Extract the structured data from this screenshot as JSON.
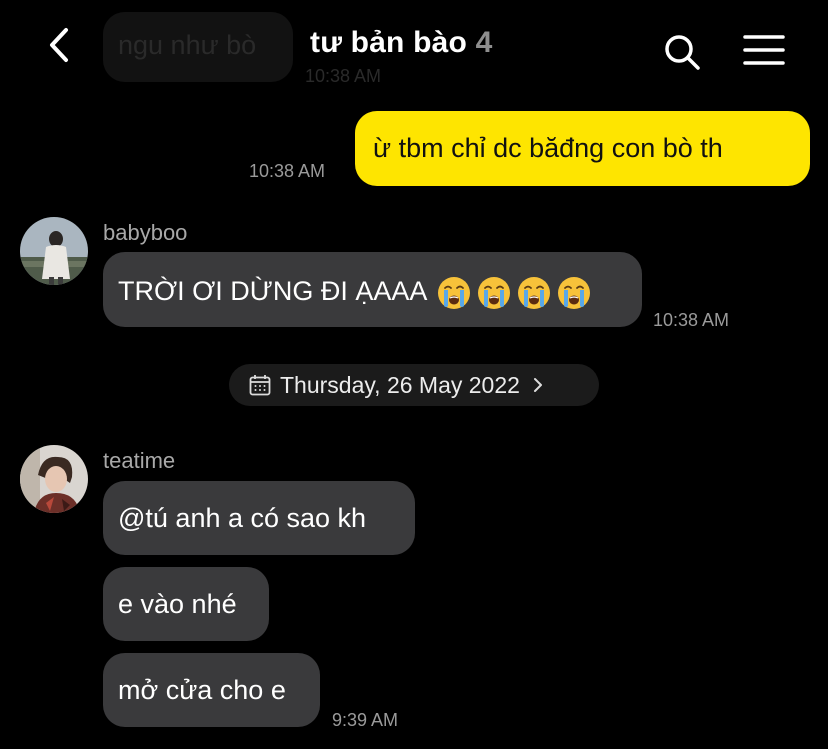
{
  "header": {
    "title": "tư bản bào",
    "member_count": "4",
    "back_icon": "chevron-left-icon",
    "search_icon": "search-icon",
    "menu_icon": "hamburger-menu-icon"
  },
  "ghost_message": {
    "text": "ngu như bò",
    "time": "10:38 AM"
  },
  "messages": [
    {
      "direction": "outgoing",
      "text": "ừ tbm chỉ dc băđng con bò th",
      "time": "10:38 AM"
    },
    {
      "direction": "incoming",
      "sender": "babyboo",
      "text": "TRỜI ƠI DỪNG ĐI ẠAAA",
      "emoji": [
        "😭",
        "😭",
        "😭",
        "😭"
      ],
      "time": "10:38 AM"
    }
  ],
  "date_divider": {
    "label": "Thursday, 26 May 2022",
    "icon": "calendar-icon"
  },
  "group2": {
    "sender": "teatime",
    "messages": [
      {
        "text": "@tú anh a có sao kh"
      },
      {
        "text": "e vào nhé"
      },
      {
        "text": "mở cửa cho e"
      }
    ],
    "time": "9:39 AM"
  },
  "colors": {
    "background": "#000000",
    "incoming_bubble": "#3a3a3c",
    "outgoing_bubble": "#fee500",
    "timestamp": "#9a9a9a",
    "count": "#8e8e8e"
  }
}
